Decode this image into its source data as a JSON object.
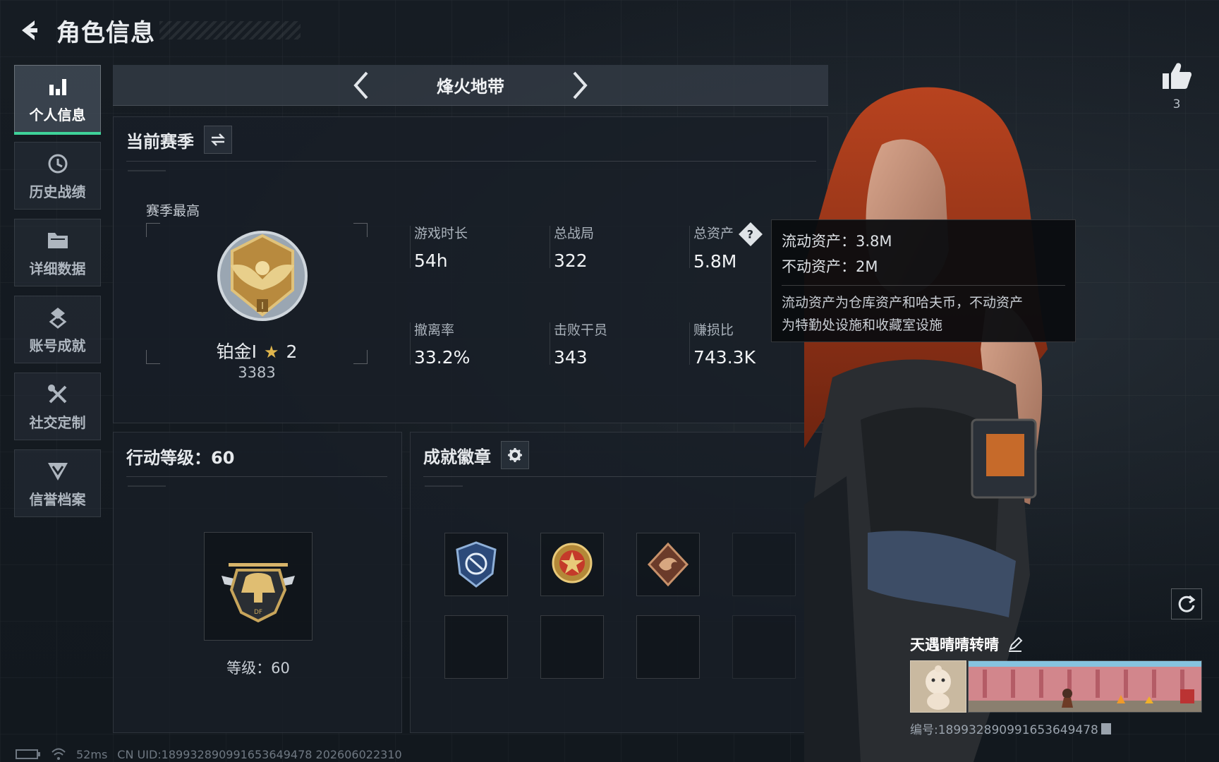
{
  "header": {
    "title": "角色信息"
  },
  "sidebar": {
    "items": [
      {
        "label": "个人信息",
        "active": true
      },
      {
        "label": "历史战绩",
        "active": false
      },
      {
        "label": "详细数据",
        "active": false
      },
      {
        "label": "账号成就",
        "active": false
      },
      {
        "label": "社交定制",
        "active": false
      },
      {
        "label": "信誉档案",
        "active": false
      }
    ]
  },
  "mode_bar": {
    "name": "烽火地带"
  },
  "season": {
    "title": "当前赛季",
    "best_label": "赛季最高",
    "rank_name": "铂金Ⅰ",
    "rank_stars": "2",
    "rank_score": "3383",
    "stats": [
      {
        "label": "游戏时长",
        "value": "54h"
      },
      {
        "label": "总战局",
        "value": "322"
      },
      {
        "label": "总资产",
        "value": "5.8M"
      },
      {
        "label": "撤离率",
        "value": "33.2%"
      },
      {
        "label": "击败干员",
        "value": "343"
      },
      {
        "label": "赚损比",
        "value": "743.3K"
      }
    ]
  },
  "tooltip": {
    "liquid": "流动资产：3.8M",
    "fixed": "不动资产：2M",
    "desc_line1": "流动资产为仓库资产和哈夫币，不动资产",
    "desc_line2": "为特勤处设施和收藏室设施"
  },
  "action_level": {
    "title": "行动等级：60",
    "level_text": "等级：60"
  },
  "badges": {
    "title": "成就徽章"
  },
  "likes": {
    "count": "3"
  },
  "player": {
    "name": "天遇晴晴转晴",
    "id_text": "编号:1899328909916536494​78"
  },
  "status": {
    "ping": "52ms",
    "uid_text": "CN UID:18993289099165364947​8 202606022310"
  },
  "colors": {
    "accent": "#3fd39a",
    "gold": "#e0b64d",
    "tooltip_bg": "#0a0c0f"
  }
}
